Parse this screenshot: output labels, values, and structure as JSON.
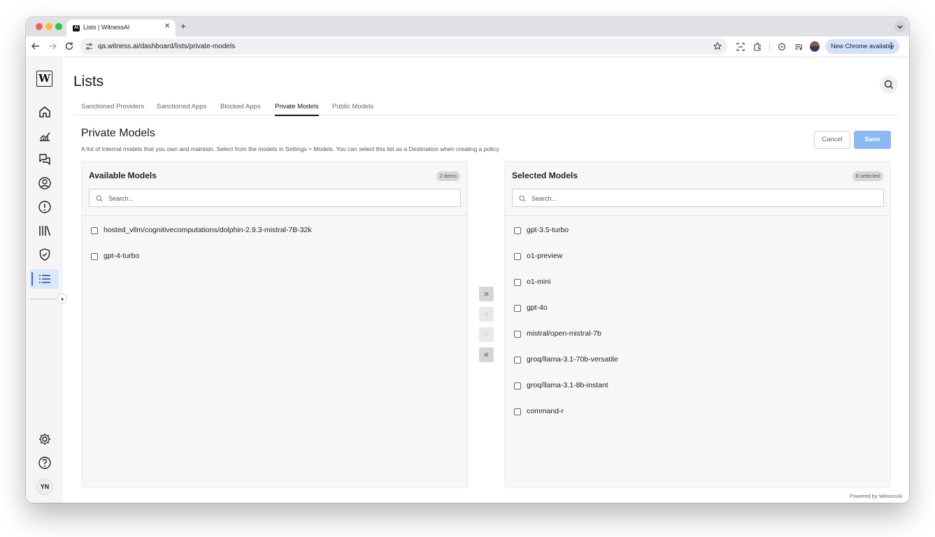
{
  "browser": {
    "tab_title": "Lists | WitnessAI",
    "favicon_text": "AI",
    "url": "qa.witness.ai/dashboard/lists/private-models",
    "update_label": "New Chrome available"
  },
  "sidebar": {
    "logo": "W",
    "items": [
      {
        "icon": "home-icon"
      },
      {
        "icon": "analytics-icon"
      },
      {
        "icon": "conversations-icon"
      },
      {
        "icon": "users-icon"
      },
      {
        "icon": "alerts-icon"
      },
      {
        "icon": "library-icon"
      },
      {
        "icon": "shield-icon"
      },
      {
        "icon": "list-icon",
        "active": true
      }
    ],
    "bottom": [
      {
        "icon": "settings-icon"
      },
      {
        "icon": "help-icon"
      }
    ],
    "user_initials": "YN"
  },
  "page": {
    "title": "Lists",
    "tabs": [
      "Sanctioned Providers",
      "Sanctioned Apps",
      "Blocked Apps",
      "Private Models",
      "Public Models"
    ],
    "active_tab": "Private Models"
  },
  "section": {
    "title": "Private Models",
    "description": "A list of internal models that you own and maintain. Select from the models in Settings > Models. You can select this list as a Destination when creating a policy.",
    "cancel_label": "Cancel",
    "save_label": "Save"
  },
  "available": {
    "title": "Available Models",
    "badge": "2 items",
    "search_placeholder": "Search...",
    "items": [
      "hosted_vllm/cognitivecomputations/dolphin-2.9.3-mistral-7B-32k",
      "gpt-4-turbo"
    ]
  },
  "selected": {
    "title": "Selected Models",
    "badge": "8 selected",
    "search_placeholder": "Search...",
    "items": [
      "gpt-3.5-turbo",
      "o1-preview",
      "o1-mini",
      "gpt-4o",
      "mistral/open-mistral-7b",
      "groq/llama-3.1-70b-versatile",
      "groq/llama-3.1-8b-instant",
      "command-r"
    ]
  },
  "transfer": {
    "move_all_right": "»",
    "move_right": "›",
    "move_left": "‹",
    "move_all_left": "«"
  },
  "footer": "Powered by WitnessAI"
}
